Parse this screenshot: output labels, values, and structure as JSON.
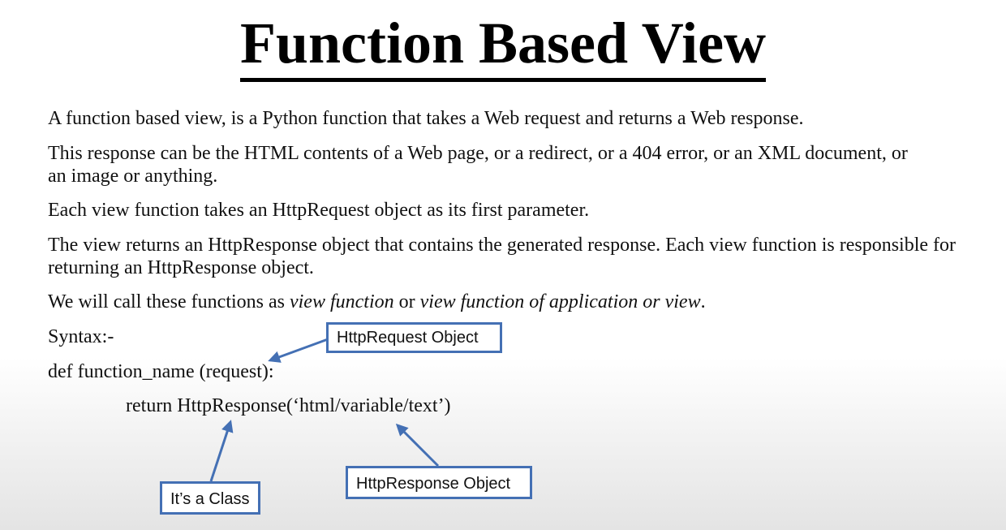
{
  "title": "Function Based View",
  "paragraphs": {
    "p1": "A function based view, is a Python function that takes a Web request and returns a Web response.",
    "p2": "This response can be the HTML contents of a Web page, or a redirect, or a 404 error, or an XML document, or an image or anything.",
    "p3": "Each view function takes an HttpRequest object as its first parameter.",
    "p4": "The view returns an HttpResponse object that contains the generated response. Each view function is responsible for returning an HttpResponse object.",
    "p5": {
      "prefix": "We will call these functions as ",
      "italic1": "view function",
      "middle": " or ",
      "italic2": "view function of application or view",
      "suffix": "."
    }
  },
  "syntax": {
    "label": "Syntax:-",
    "def_line": "def function_name (request):",
    "return_line": "return HttpResponse(‘html/variable/text’)"
  },
  "callouts": {
    "request_object": "HttpRequest Object",
    "class_note": "It’s a Class",
    "response_object": "HttpResponse Object"
  },
  "colors": {
    "callout_border": "#4470b4",
    "arrow": "#4470b4"
  }
}
